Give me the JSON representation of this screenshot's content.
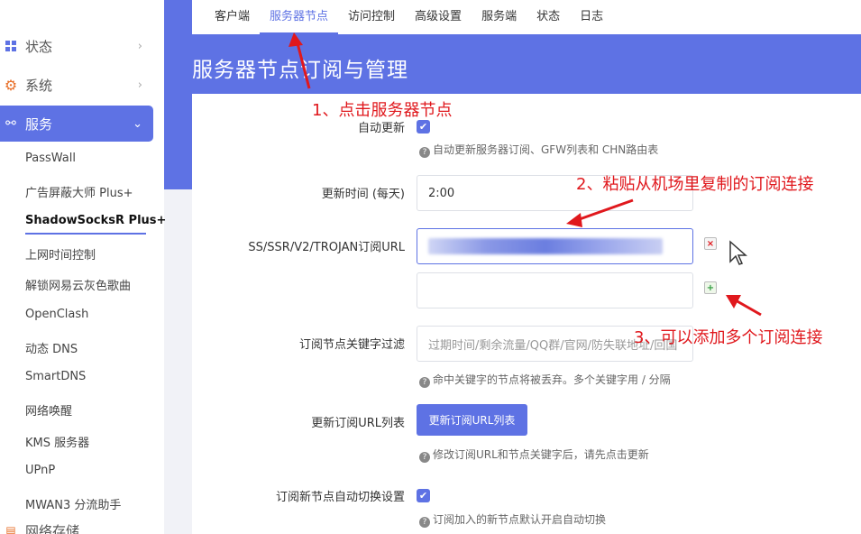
{
  "sidebar": {
    "main_items": [
      {
        "label": "状态",
        "icon": "grid-icon"
      },
      {
        "label": "系统",
        "icon": "gear-icon"
      },
      {
        "label": "服务",
        "icon": "link-icon"
      }
    ],
    "sub_items": [
      "PassWall",
      "广告屏蔽大师 Plus+",
      "ShadowSocksR Plus+",
      "上网时间控制",
      "解锁网易云灰色歌曲",
      "OpenClash",
      "动态 DNS",
      "SmartDNS",
      "网络唤醒",
      "KMS 服务器",
      "UPnP",
      "MWAN3 分流助手",
      "网络存储"
    ]
  },
  "tabs": [
    "客户端",
    "服务器节点",
    "访问控制",
    "高级设置",
    "服务端",
    "状态",
    "日志"
  ],
  "page_title": "服务器节点订阅与管理",
  "form": {
    "auto_update": {
      "label": "自动更新",
      "checked": true,
      "hint": "自动更新服务器订阅、GFW列表和 CHN路由表"
    },
    "update_time": {
      "label": "更新时间 (每天)",
      "value": "2:00"
    },
    "sub_url": {
      "label": "SS/SSR/V2/TROJAN订阅URL"
    },
    "keyword_filter": {
      "label": "订阅节点关键字过滤",
      "placeholder": "过期时间/剩余流量/QQ群/官网/防失联地址/回国",
      "hint": "命中关键字的节点将被丢弃。多个关键字用 / 分隔"
    },
    "update_list": {
      "label": "更新订阅URL列表",
      "button": "更新订阅URL列表",
      "hint": "修改订阅URL和节点关键字后，请先点击更新"
    },
    "auto_switch": {
      "label": "订阅新节点自动切换设置",
      "checked": true,
      "hint": "订阅加入的新节点默认开启自动切换"
    }
  },
  "annotations": {
    "step1": "1、点击服务器节点",
    "step2": "2、粘贴从机场里复制的订阅连接",
    "step3": "3、可以添加多个订阅连接"
  },
  "colors": {
    "accent": "#5e72e4",
    "annotation": "#e0181d"
  }
}
